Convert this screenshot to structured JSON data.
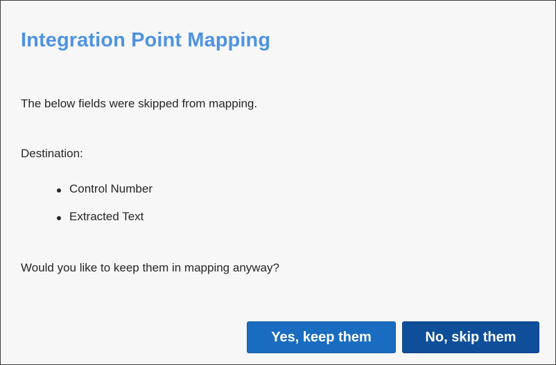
{
  "dialog": {
    "title": "Integration Point Mapping",
    "message": "The below fields were skipped from mapping.",
    "destination_label": "Destination:",
    "fields": [
      "Control Number",
      "Extracted Text"
    ],
    "question": "Would you like to keep them in mapping anyway?",
    "buttons": {
      "yes_label": "Yes, keep them",
      "no_label": "No, skip them"
    }
  },
  "colors": {
    "title": "#4e93e0",
    "yes_button": "#1a6cc0",
    "no_button": "#0f4f9a",
    "background": "#f7f7f7"
  }
}
